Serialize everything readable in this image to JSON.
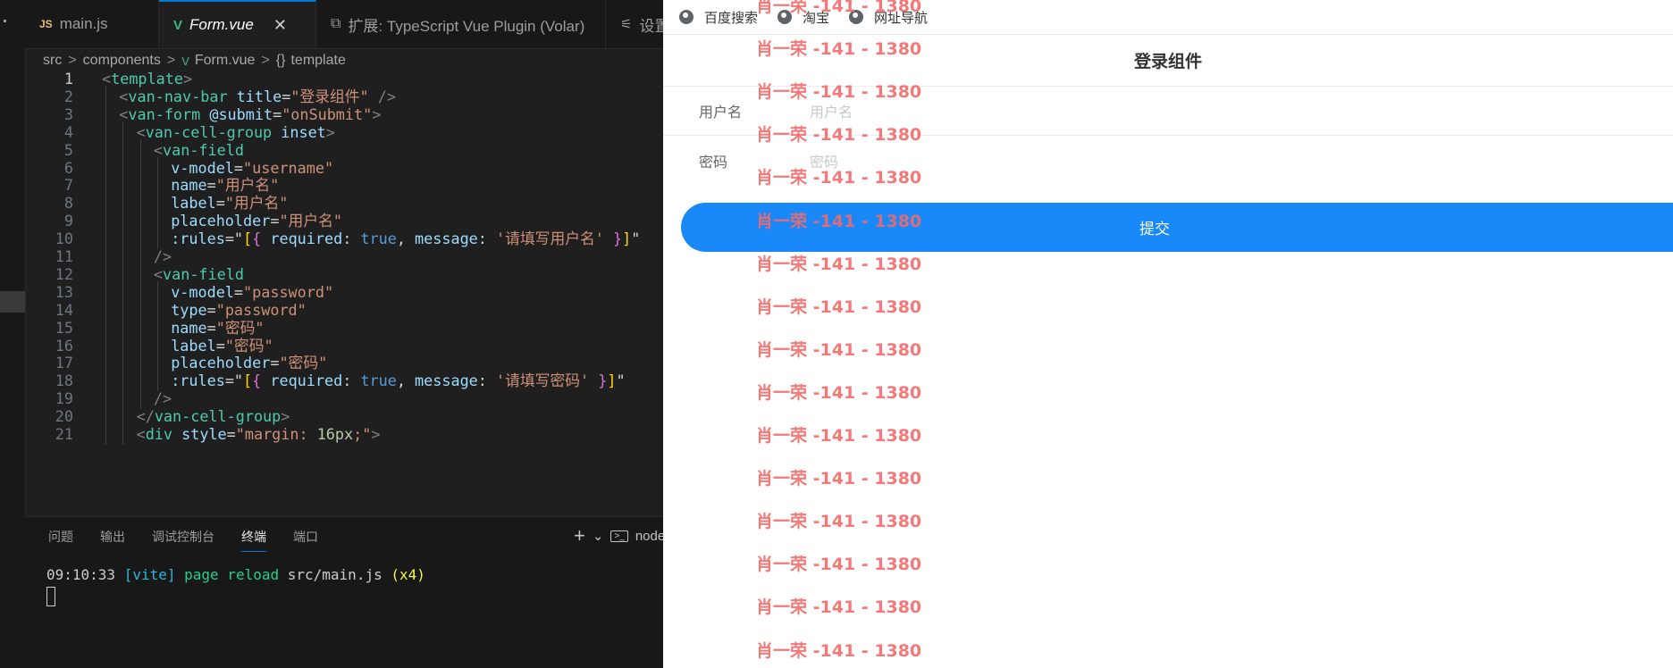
{
  "editor": {
    "tabs": [
      {
        "icon": "JS",
        "label": "main.js"
      },
      {
        "icon": "V",
        "label": "Form.vue",
        "close": "✕"
      },
      {
        "icon": "⧉",
        "label": "扩展: TypeScript Vue Plugin (Volar)"
      },
      {
        "icon": "⚟",
        "label": "设置"
      }
    ],
    "breadcrumb": {
      "parts": [
        "src",
        "components",
        "Form.vue",
        "template"
      ],
      "sep": ">",
      "vue_icon": "V",
      "template_icon": "{}"
    },
    "active_line": 1,
    "lines": [
      {
        "n": "1",
        "indent": 0,
        "tokens": [
          [
            "t-br",
            "<"
          ],
          [
            "t-tag",
            "template"
          ],
          [
            "t-br",
            ">"
          ]
        ]
      },
      {
        "n": "2",
        "indent": 1,
        "tokens": [
          [
            "t-br",
            "<"
          ],
          [
            "t-tag",
            "van-nav-bar"
          ],
          [
            "",
            " "
          ],
          [
            "t-attr",
            "title"
          ],
          [
            "",
            "="
          ],
          [
            "t-str",
            "\"登录组件\""
          ],
          [
            "",
            " "
          ],
          [
            "t-br",
            "/>"
          ]
        ]
      },
      {
        "n": "3",
        "indent": 1,
        "tokens": [
          [
            "t-br",
            "<"
          ],
          [
            "t-tag",
            "van-form"
          ],
          [
            "",
            " "
          ],
          [
            "t-attr",
            "@submit"
          ],
          [
            "",
            "="
          ],
          [
            "t-str",
            "\"onSubmit\""
          ],
          [
            "t-br",
            ">"
          ]
        ]
      },
      {
        "n": "4",
        "indent": 2,
        "tokens": [
          [
            "t-br",
            "<"
          ],
          [
            "t-tag",
            "van-cell-group"
          ],
          [
            "",
            " "
          ],
          [
            "t-attr",
            "inset"
          ],
          [
            "t-br",
            ">"
          ]
        ]
      },
      {
        "n": "5",
        "indent": 3,
        "tokens": [
          [
            "t-br",
            "<"
          ],
          [
            "t-tag",
            "van-field"
          ]
        ]
      },
      {
        "n": "6",
        "indent": 4,
        "tokens": [
          [
            "t-attr",
            "v-model"
          ],
          [
            "",
            "="
          ],
          [
            "t-str",
            "\"username\""
          ]
        ]
      },
      {
        "n": "7",
        "indent": 4,
        "tokens": [
          [
            "t-attr",
            "name"
          ],
          [
            "",
            "="
          ],
          [
            "t-str",
            "\"用户名\""
          ]
        ]
      },
      {
        "n": "8",
        "indent": 4,
        "tokens": [
          [
            "t-attr",
            "label"
          ],
          [
            "",
            "="
          ],
          [
            "t-str",
            "\"用户名\""
          ]
        ]
      },
      {
        "n": "9",
        "indent": 4,
        "tokens": [
          [
            "t-attr",
            "placeholder"
          ],
          [
            "",
            "="
          ],
          [
            "t-str",
            "\"用户名\""
          ]
        ]
      },
      {
        "n": "10",
        "indent": 4,
        "tokens": [
          [
            "t-attr",
            ":rules"
          ],
          [
            "",
            "=\""
          ],
          [
            "t-b1",
            "["
          ],
          [
            "t-b2",
            "{"
          ],
          [
            "",
            " "
          ],
          [
            "t-prop",
            "required"
          ],
          [
            "",
            ": "
          ],
          [
            "t-kw",
            "true"
          ],
          [
            "",
            ", "
          ],
          [
            "t-prop",
            "message"
          ],
          [
            "",
            ": "
          ],
          [
            "t-str",
            "'请填写用户名'"
          ],
          [
            "",
            " "
          ],
          [
            "t-b2",
            "}"
          ],
          [
            "t-b1",
            "]"
          ],
          [
            "",
            "\""
          ]
        ]
      },
      {
        "n": "11",
        "indent": 3,
        "tokens": [
          [
            "t-br",
            "/>"
          ]
        ]
      },
      {
        "n": "12",
        "indent": 3,
        "tokens": [
          [
            "t-br",
            "<"
          ],
          [
            "t-tag",
            "van-field"
          ]
        ]
      },
      {
        "n": "13",
        "indent": 4,
        "tokens": [
          [
            "t-attr",
            "v-model"
          ],
          [
            "",
            "="
          ],
          [
            "t-str",
            "\"password\""
          ]
        ]
      },
      {
        "n": "14",
        "indent": 4,
        "tokens": [
          [
            "t-attr",
            "type"
          ],
          [
            "",
            "="
          ],
          [
            "t-str",
            "\"password\""
          ]
        ]
      },
      {
        "n": "15",
        "indent": 4,
        "tokens": [
          [
            "t-attr",
            "name"
          ],
          [
            "",
            "="
          ],
          [
            "t-str",
            "\"密码\""
          ]
        ]
      },
      {
        "n": "16",
        "indent": 4,
        "tokens": [
          [
            "t-attr",
            "label"
          ],
          [
            "",
            "="
          ],
          [
            "t-str",
            "\"密码\""
          ]
        ]
      },
      {
        "n": "17",
        "indent": 4,
        "tokens": [
          [
            "t-attr",
            "placeholder"
          ],
          [
            "",
            "="
          ],
          [
            "t-str",
            "\"密码\""
          ]
        ]
      },
      {
        "n": "18",
        "indent": 4,
        "tokens": [
          [
            "t-attr",
            ":rules"
          ],
          [
            "",
            "=\""
          ],
          [
            "t-b1",
            "["
          ],
          [
            "t-b2",
            "{"
          ],
          [
            "",
            " "
          ],
          [
            "t-prop",
            "required"
          ],
          [
            "",
            ": "
          ],
          [
            "t-kw",
            "true"
          ],
          [
            "",
            ", "
          ],
          [
            "t-prop",
            "message"
          ],
          [
            "",
            ": "
          ],
          [
            "t-str",
            "'请填写密码'"
          ],
          [
            "",
            " "
          ],
          [
            "t-b2",
            "}"
          ],
          [
            "t-b1",
            "]"
          ],
          [
            "",
            "\""
          ]
        ]
      },
      {
        "n": "19",
        "indent": 3,
        "tokens": [
          [
            "t-br",
            "/>"
          ]
        ]
      },
      {
        "n": "20",
        "indent": 2,
        "tokens": [
          [
            "t-br",
            "</"
          ],
          [
            "t-tag",
            "van-cell-group"
          ],
          [
            "t-br",
            ">"
          ]
        ]
      },
      {
        "n": "21",
        "indent": 2,
        "tokens": [
          [
            "t-br",
            "<"
          ],
          [
            "t-tag",
            "div"
          ],
          [
            "",
            " "
          ],
          [
            "t-attr",
            "style"
          ],
          [
            "",
            "="
          ],
          [
            "t-str",
            "\"margin: "
          ],
          [
            "t-num",
            "16px"
          ],
          [
            "t-str",
            ";\""
          ],
          [
            "t-br",
            ">"
          ]
        ]
      }
    ],
    "panel": {
      "tabs": [
        "问题",
        "输出",
        "调试控制台",
        "终端",
        "端口"
      ],
      "active": "终端",
      "plus": "+",
      "chevron": "⌄",
      "terminal_label": "node",
      "terminal": {
        "time": "09:10:33",
        "tag": "[vite]",
        "msg": "page reload",
        "file": "src/main.js",
        "count": "(x4)"
      }
    }
  },
  "browser": {
    "bookmarks": [
      "百度搜索",
      "淘宝",
      "网址导航"
    ],
    "nav_title": "登录组件",
    "fields": [
      {
        "label": "用户名",
        "placeholder": "用户名"
      },
      {
        "label": "密码",
        "placeholder": "密码"
      }
    ],
    "submit": "提交",
    "watermark": "肖一荣 -141 - 1380",
    "watermark_count": 16
  }
}
